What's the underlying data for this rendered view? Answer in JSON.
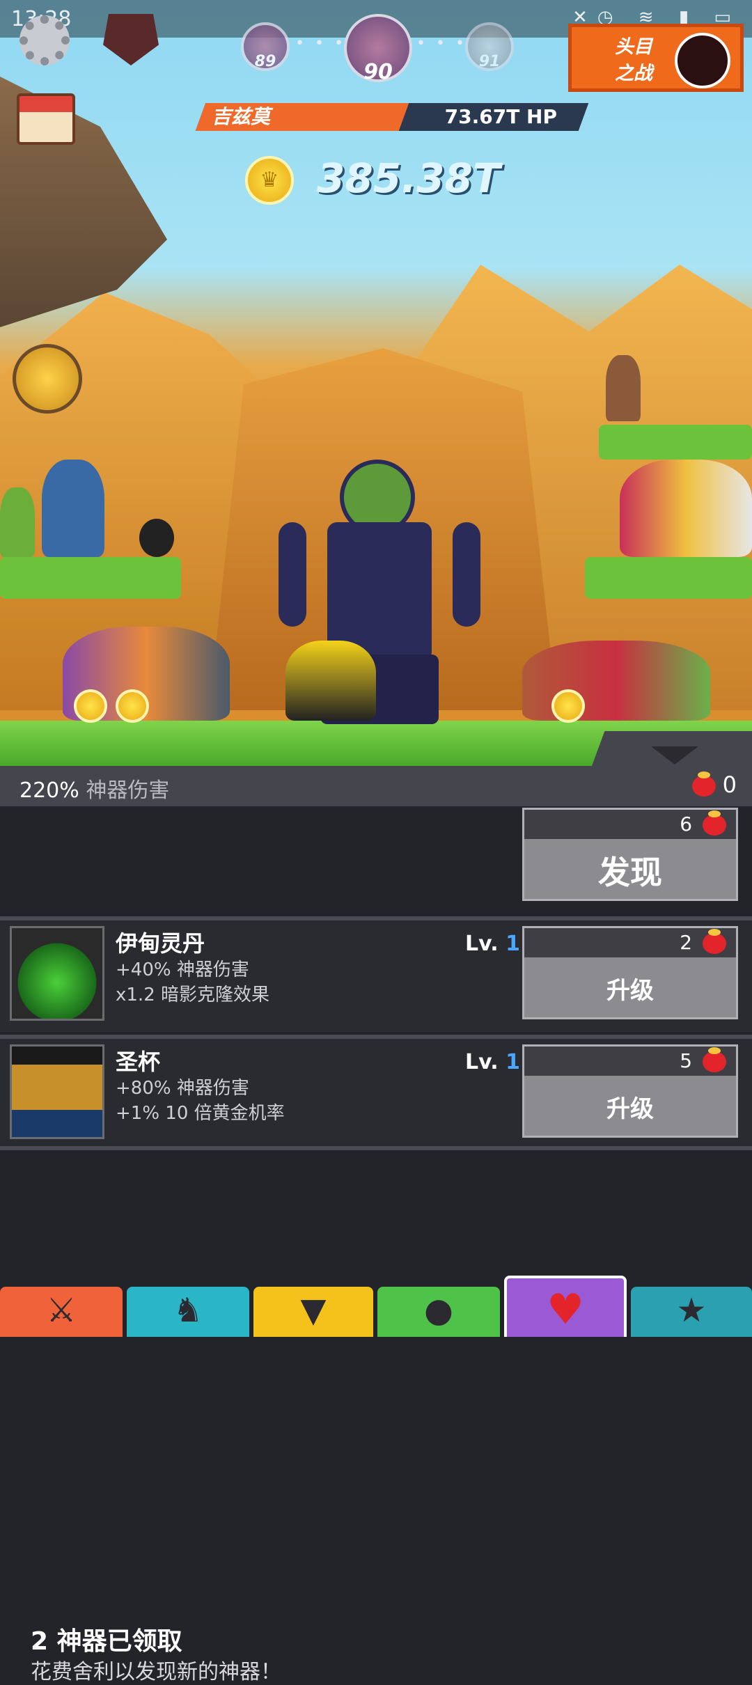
{
  "status": {
    "time": "13:28"
  },
  "stages": {
    "prev": "89",
    "current": "90",
    "next": "91"
  },
  "boss_button": {
    "label_line1": "头目",
    "label_line2": "之战"
  },
  "boss_hp": {
    "name": "吉兹莫",
    "hp": "73.67T HP",
    "fill_fraction": 0.53
  },
  "gold": {
    "amount": "385.38T"
  },
  "damage_bar": {
    "percent": "220%",
    "label": "神器伤害"
  },
  "relics": {
    "count": "0"
  },
  "discover": {
    "title": "2 神器已领取",
    "subtitle": "花费舍利以发现新的神器！",
    "cost": "6",
    "button_label": "发现"
  },
  "artifacts": [
    {
      "name": "伊甸灵丹",
      "line1": "+40% 神器伤害",
      "line2": "x1.2 暗影克隆效果",
      "level_prefix": "Lv.",
      "level": "1",
      "cost": "2",
      "button_label": "升级"
    },
    {
      "name": "圣杯",
      "line1": "+80% 神器伤害",
      "line2": "+1% 10 倍黄金机率",
      "level_prefix": "Lv.",
      "level": "1",
      "cost": "5",
      "button_label": "升级"
    }
  ],
  "tabs": [
    {
      "icon": "sword-icon",
      "color": "#f0623a"
    },
    {
      "icon": "hero-icon",
      "color": "#2bb6c8"
    },
    {
      "icon": "shirt-icon",
      "color": "#f4c21a"
    },
    {
      "icon": "pet-icon",
      "color": "#4fc24a"
    },
    {
      "icon": "relic-heart-icon",
      "color": "#9a5ad6"
    },
    {
      "icon": "star-icon",
      "color": "#2aa0b0"
    }
  ]
}
